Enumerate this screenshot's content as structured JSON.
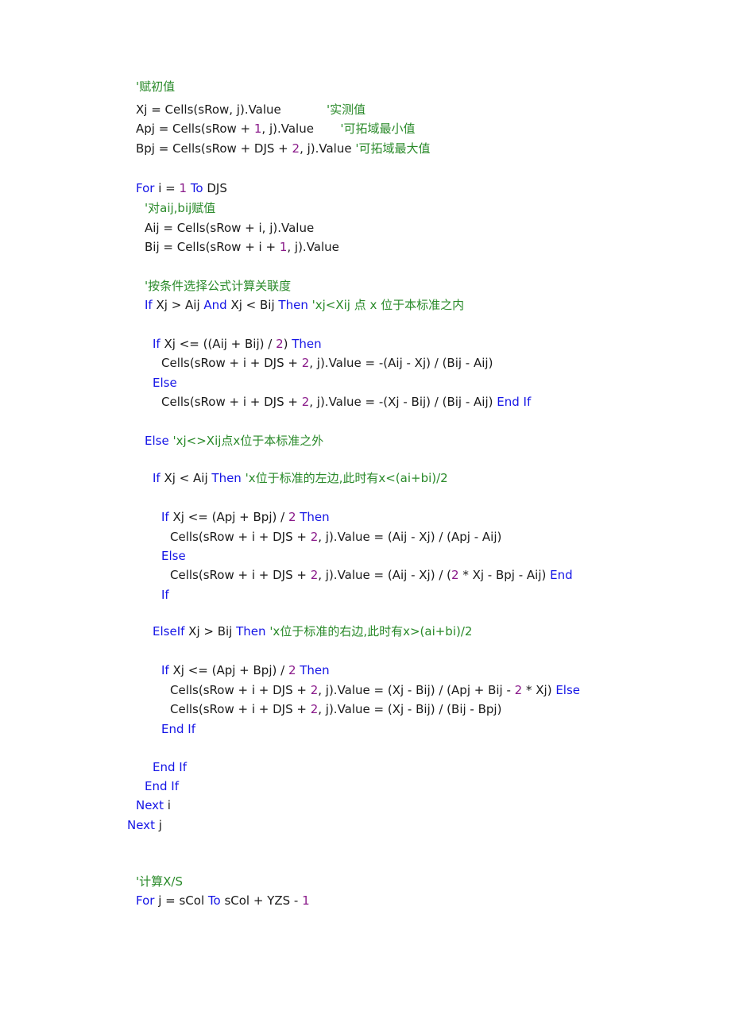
{
  "colors": {
    "keyword": "#1515e6",
    "number": "#8a1a8a",
    "comment": "#2a8a2a",
    "text": "#1a1a1a"
  },
  "lines": [
    [
      {
        "t": "cm",
        "v": "'赋初值"
      }
    ],
    [
      {
        "t": "tx",
        "v": "Xj = Cells(sRow, j).Value"
      },
      {
        "t": "tx",
        "v": "            "
      },
      {
        "t": "cm",
        "v": "'实测值"
      }
    ],
    [
      {
        "t": "tx",
        "v": "Apj = Cells(sRow + "
      },
      {
        "t": "num",
        "v": "1"
      },
      {
        "t": "tx",
        "v": ", j).Value       "
      },
      {
        "t": "cm",
        "v": "'可拓域最小值"
      }
    ],
    [
      {
        "t": "tx",
        "v": "Bpj = Cells(sRow + DJS + "
      },
      {
        "t": "num",
        "v": "2"
      },
      {
        "t": "tx",
        "v": ", j).Value "
      },
      {
        "t": "cm",
        "v": "'可拓域最大值"
      }
    ],
    [
      {
        "t": "kw",
        "v": "For"
      },
      {
        "t": "tx",
        "v": " i = "
      },
      {
        "t": "num",
        "v": "1"
      },
      {
        "t": "tx",
        "v": " "
      },
      {
        "t": "kw",
        "v": "To"
      },
      {
        "t": "tx",
        "v": " DJS"
      }
    ],
    [
      {
        "t": "cm",
        "v": "'对aij,bij赋值"
      }
    ],
    [
      {
        "t": "tx",
        "v": "Aij = Cells(sRow + i, j).Value"
      }
    ],
    [
      {
        "t": "tx",
        "v": "Bij = Cells(sRow + i + "
      },
      {
        "t": "num",
        "v": "1"
      },
      {
        "t": "tx",
        "v": ", j).Value"
      }
    ],
    [
      {
        "t": "cm",
        "v": "'按条件选择公式计算关联度"
      }
    ],
    [
      {
        "t": "kw",
        "v": "If"
      },
      {
        "t": "tx",
        "v": " Xj > Aij "
      },
      {
        "t": "kw",
        "v": "And"
      },
      {
        "t": "tx",
        "v": " Xj < Bij "
      },
      {
        "t": "kw",
        "v": "Then"
      },
      {
        "t": "tx",
        "v": " "
      },
      {
        "t": "cm",
        "v": "'xj<Xij 点 x 位于本标准之内"
      }
    ],
    [
      {
        "t": "kw",
        "v": "If"
      },
      {
        "t": "tx",
        "v": " Xj <= ((Aij + Bij) / "
      },
      {
        "t": "num",
        "v": "2"
      },
      {
        "t": "tx",
        "v": ") "
      },
      {
        "t": "kw",
        "v": "Then"
      }
    ],
    [
      {
        "t": "tx",
        "v": "Cells(sRow + i + DJS + "
      },
      {
        "t": "num",
        "v": "2"
      },
      {
        "t": "tx",
        "v": ", j).Value = -(Aij - Xj) / (Bij - Aij)"
      }
    ],
    [
      {
        "t": "kw",
        "v": "Else"
      }
    ],
    [
      {
        "t": "tx",
        "v": "Cells(sRow + i + DJS + "
      },
      {
        "t": "num",
        "v": "2"
      },
      {
        "t": "tx",
        "v": ", j).Value = -(Xj - Bij) / (Bij - Aij) "
      },
      {
        "t": "kw",
        "v": "End If"
      }
    ],
    [
      {
        "t": "kw",
        "v": "Else"
      },
      {
        "t": "tx",
        "v": " "
      },
      {
        "t": "cm",
        "v": "'xj<>Xij点x位于本标准之外"
      }
    ],
    [
      {
        "t": "kw",
        "v": "If"
      },
      {
        "t": "tx",
        "v": " Xj < Aij "
      },
      {
        "t": "kw",
        "v": "Then"
      },
      {
        "t": "tx",
        "v": " "
      },
      {
        "t": "cm",
        "v": "'x位于标准的左边,此时有x<(ai+bi)/2"
      }
    ],
    [
      {
        "t": "kw",
        "v": "If"
      },
      {
        "t": "tx",
        "v": " Xj <= (Apj + Bpj) / "
      },
      {
        "t": "num",
        "v": "2"
      },
      {
        "t": "tx",
        "v": " "
      },
      {
        "t": "kw",
        "v": "Then"
      }
    ],
    [
      {
        "t": "tx",
        "v": "Cells(sRow + i + DJS + "
      },
      {
        "t": "num",
        "v": "2"
      },
      {
        "t": "tx",
        "v": ", j).Value = (Aij - Xj) / (Apj - Aij)"
      }
    ],
    [
      {
        "t": "kw",
        "v": "Else"
      }
    ],
    [
      {
        "t": "tx",
        "v": "Cells(sRow + i + DJS + "
      },
      {
        "t": "num",
        "v": "2"
      },
      {
        "t": "tx",
        "v": ", j).Value = (Aij - Xj) / ("
      },
      {
        "t": "num",
        "v": "2"
      },
      {
        "t": "tx",
        "v": " * Xj - Bpj - Aij) "
      },
      {
        "t": "kw",
        "v": "End"
      }
    ],
    [
      {
        "t": "kw",
        "v": "If"
      }
    ],
    [
      {
        "t": "kw",
        "v": "ElseIf"
      },
      {
        "t": "tx",
        "v": " Xj > Bij "
      },
      {
        "t": "kw",
        "v": "Then"
      },
      {
        "t": "tx",
        "v": " "
      },
      {
        "t": "cm",
        "v": "'x位于标准的右边,此时有x>(ai+bi)/2"
      }
    ],
    [
      {
        "t": "kw",
        "v": "If"
      },
      {
        "t": "tx",
        "v": " Xj <= (Apj + Bpj) / "
      },
      {
        "t": "num",
        "v": "2"
      },
      {
        "t": "tx",
        "v": " "
      },
      {
        "t": "kw",
        "v": "Then"
      }
    ],
    [
      {
        "t": "tx",
        "v": "Cells(sRow + i + DJS + "
      },
      {
        "t": "num",
        "v": "2"
      },
      {
        "t": "tx",
        "v": ", j).Value = (Xj - Bij) / (Apj + Bij - "
      },
      {
        "t": "num",
        "v": "2"
      },
      {
        "t": "tx",
        "v": " * Xj) "
      },
      {
        "t": "kw",
        "v": "Else"
      }
    ],
    [
      {
        "t": "tx",
        "v": "Cells(sRow + i + DJS + "
      },
      {
        "t": "num",
        "v": "2"
      },
      {
        "t": "tx",
        "v": ", j).Value = (Xj - Bij) / (Bij - Bpj)"
      }
    ],
    [
      {
        "t": "kw",
        "v": "End If"
      }
    ],
    [
      {
        "t": "kw",
        "v": "End If"
      }
    ],
    [
      {
        "t": "kw",
        "v": "End If"
      }
    ],
    [
      {
        "t": "kw",
        "v": "Next"
      },
      {
        "t": "tx",
        "v": " i"
      }
    ],
    [
      {
        "t": "kw",
        "v": "Next"
      },
      {
        "t": "tx",
        "v": " j"
      }
    ],
    [
      {
        "t": "cm",
        "v": "'计算X/S"
      }
    ],
    [
      {
        "t": "kw",
        "v": "For"
      },
      {
        "t": "tx",
        "v": " j = sCol "
      },
      {
        "t": "kw",
        "v": "To"
      },
      {
        "t": "tx",
        "v": " sCol + YZS - "
      },
      {
        "t": "num",
        "v": "1"
      }
    ]
  ]
}
